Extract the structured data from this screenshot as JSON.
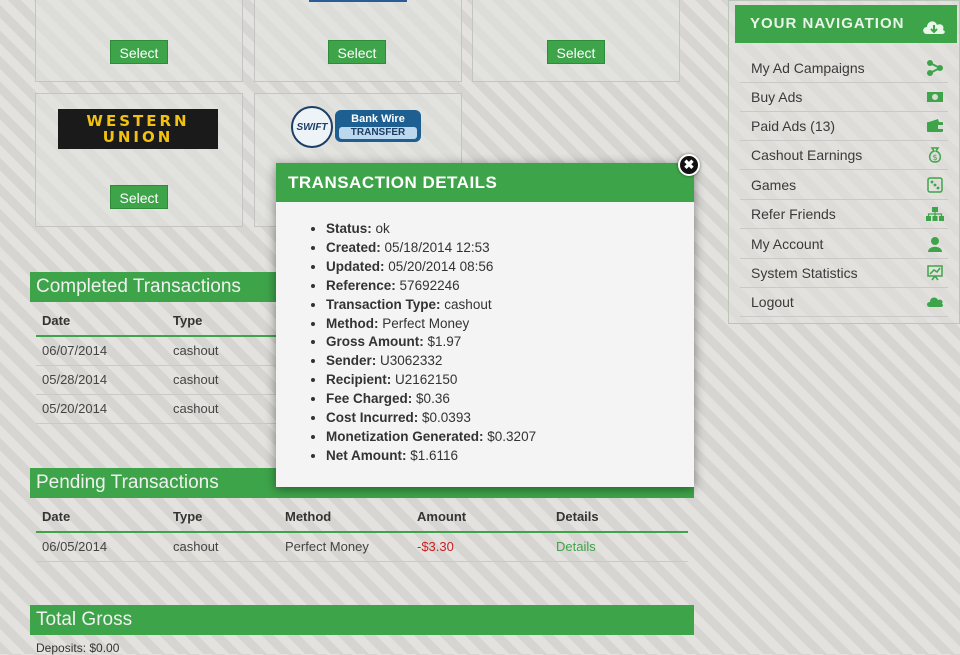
{
  "payment_methods": {
    "select_label": "Select",
    "western_union_logo": "WESTERN\nUNION",
    "swift_logo": "SWIFT",
    "bank_wire_logo": "Bank Wire",
    "bank_wire_sub": "TRANSFER"
  },
  "completed": {
    "title": "Completed Transactions",
    "columns": [
      "Date",
      "Type"
    ],
    "rows": [
      {
        "date": "06/07/2014",
        "type": "cashout"
      },
      {
        "date": "05/28/2014",
        "type": "cashout"
      },
      {
        "date": "05/20/2014",
        "type": "cashout"
      }
    ]
  },
  "pending": {
    "title": "Pending Transactions",
    "columns": [
      "Date",
      "Type",
      "Method",
      "Amount",
      "Details"
    ],
    "rows": [
      {
        "date": "06/05/2014",
        "type": "cashout",
        "method": "Perfect Money",
        "amount": "-$3.30",
        "details": "Details"
      }
    ]
  },
  "total_gross": {
    "title": "Total Gross",
    "deposits": "Deposits: $0.00"
  },
  "navigation": {
    "title": "YOUR NAVIGATION",
    "items": [
      {
        "label": "My Ad Campaigns",
        "icon": "share-icon"
      },
      {
        "label": "Buy Ads",
        "icon": "money-icon"
      },
      {
        "label": "Paid Ads (13)",
        "icon": "wallet-icon"
      },
      {
        "label": "Cashout Earnings",
        "icon": "money-bag-icon"
      },
      {
        "label": "Games",
        "icon": "dice-icon"
      },
      {
        "label": "Refer Friends",
        "icon": "sitemap-icon"
      },
      {
        "label": "My Account",
        "icon": "user-icon"
      },
      {
        "label": "System Statistics",
        "icon": "chart-icon"
      },
      {
        "label": "Logout",
        "icon": "cloud-icon"
      }
    ]
  },
  "modal": {
    "title": "TRANSACTION DETAILS",
    "close_symbol": "✖",
    "fields": [
      {
        "label": "Status:",
        "value": "ok"
      },
      {
        "label": "Created:",
        "value": "05/18/2014 12:53"
      },
      {
        "label": "Updated:",
        "value": "05/20/2014 08:56"
      },
      {
        "label": "Reference:",
        "value": "57692246"
      },
      {
        "label": "Transaction Type:",
        "value": "cashout"
      },
      {
        "label": "Method:",
        "value": "Perfect Money"
      },
      {
        "label": "Gross Amount:",
        "value": "$1.97"
      },
      {
        "label": "Sender:",
        "value": "U3062332"
      },
      {
        "label": "Recipient:",
        "value": "U2162150"
      },
      {
        "label": "Fee Charged:",
        "value": "$0.36"
      },
      {
        "label": "Cost Incurred:",
        "value": "$0.0393"
      },
      {
        "label": "Monetization Generated:",
        "value": "$0.3207"
      },
      {
        "label": "Net Amount:",
        "value": "$1.6116"
      }
    ]
  },
  "colors": {
    "accent": "#3ea44a",
    "negative": "#cc1f1f"
  }
}
